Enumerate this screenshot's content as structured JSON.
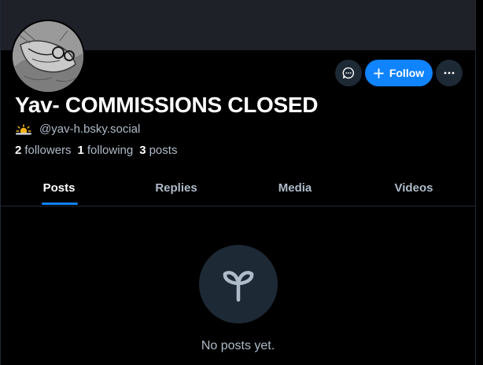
{
  "profile": {
    "display_name": "Yav- COMMISSIONS CLOSED",
    "handle": "@yav-h.bsky.social",
    "handle_emoji": "sun-behind-cloud-icon"
  },
  "actions": {
    "follow_label": "Follow"
  },
  "stats": {
    "followers_count": "2",
    "followers_label": "followers",
    "following_count": "1",
    "following_label": "following",
    "posts_count": "3",
    "posts_label": "posts"
  },
  "tabs": [
    {
      "label": "Posts",
      "active": true
    },
    {
      "label": "Replies",
      "active": false
    },
    {
      "label": "Media",
      "active": false
    },
    {
      "label": "Videos",
      "active": false
    }
  ],
  "empty_state": {
    "icon": "seedling-icon",
    "text": "No posts yet."
  },
  "colors": {
    "accent": "#1083fe",
    "background": "#000000",
    "surface": "#1e2936",
    "banner": "#1e2127",
    "muted_text": "#aebbc9"
  }
}
